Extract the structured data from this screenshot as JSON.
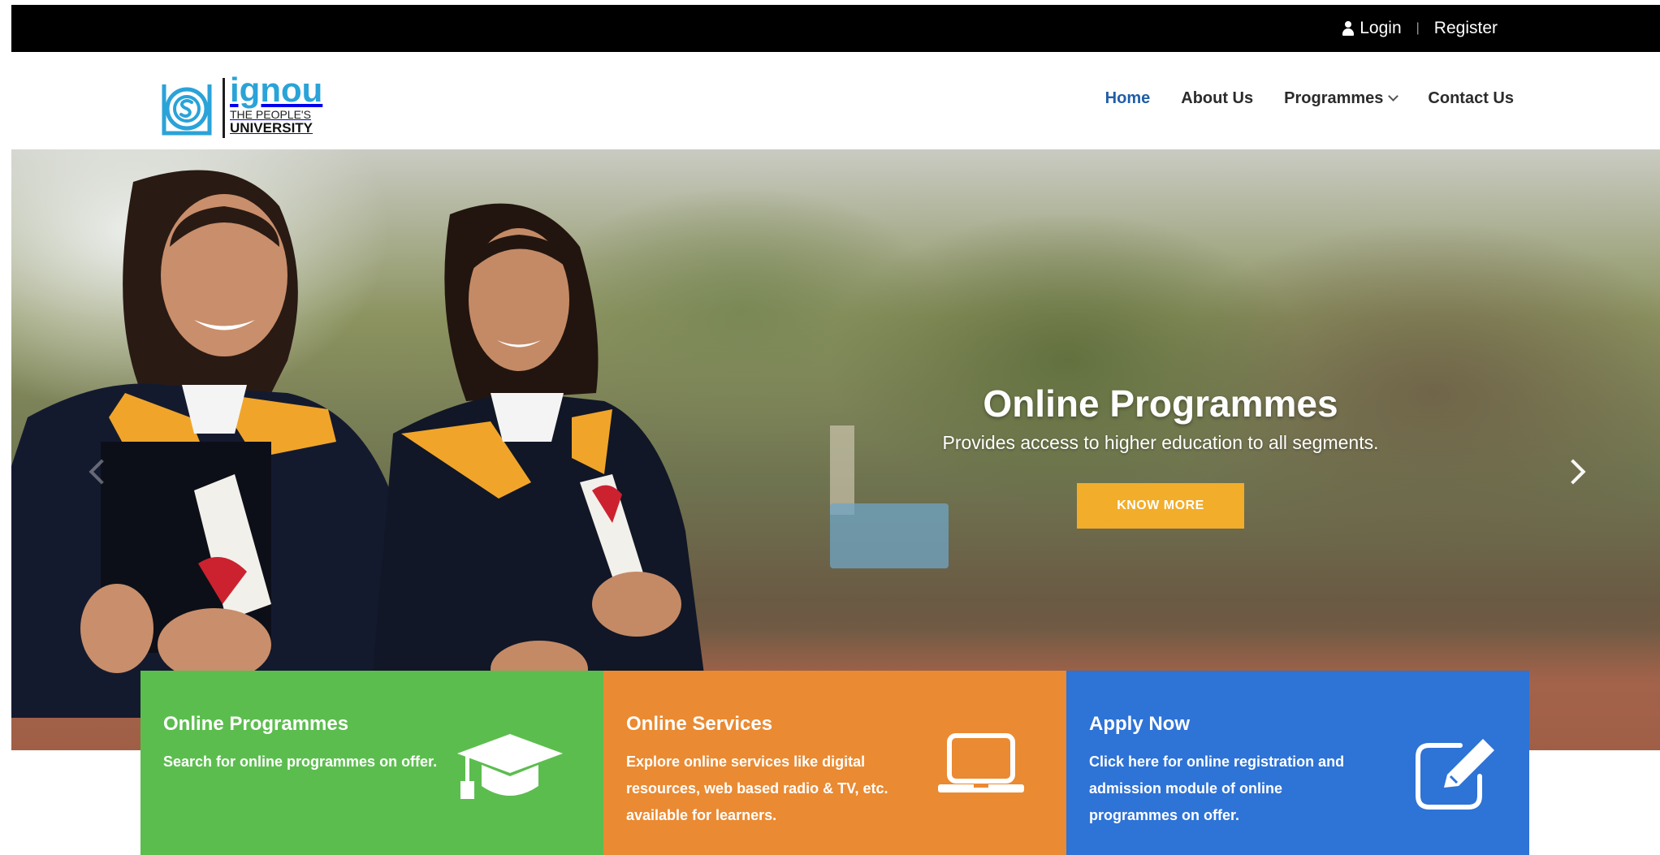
{
  "topbar": {
    "login_label": "Login",
    "separator": "|",
    "register_label": "Register"
  },
  "logo": {
    "brand": "ignou",
    "tagline_line1": "THE PEOPLE'S",
    "tagline_line2": "UNIVERSITY"
  },
  "nav": {
    "items": [
      {
        "label": "Home",
        "active": true
      },
      {
        "label": "About Us",
        "active": false
      },
      {
        "label": "Programmes",
        "active": false,
        "has_dropdown": true
      },
      {
        "label": "Contact Us",
        "active": false
      }
    ]
  },
  "hero": {
    "title": "Online Programmes",
    "subtitle": "Provides access to higher education to all segments.",
    "button_label": "KNOW MORE"
  },
  "cards": [
    {
      "title": "Online Programmes",
      "description": "Search for online programmes on offer.",
      "icon": "graduation-cap-icon",
      "color": "#5cbd4f"
    },
    {
      "title": "Online Services",
      "description": "Explore online services like digital resources, web based radio & TV, etc. available for learners.",
      "icon": "laptop-icon",
      "color": "#ea8a32"
    },
    {
      "title": "Apply Now",
      "description": "Click here for online registration and admission module of online programmes on offer.",
      "icon": "edit-icon",
      "color": "#2e73d6"
    }
  ],
  "colors": {
    "topbar": "#000000",
    "nav_active": "#1f5ea8",
    "button": "#f2ad2b",
    "logo_blue": "#2aa3d8"
  }
}
